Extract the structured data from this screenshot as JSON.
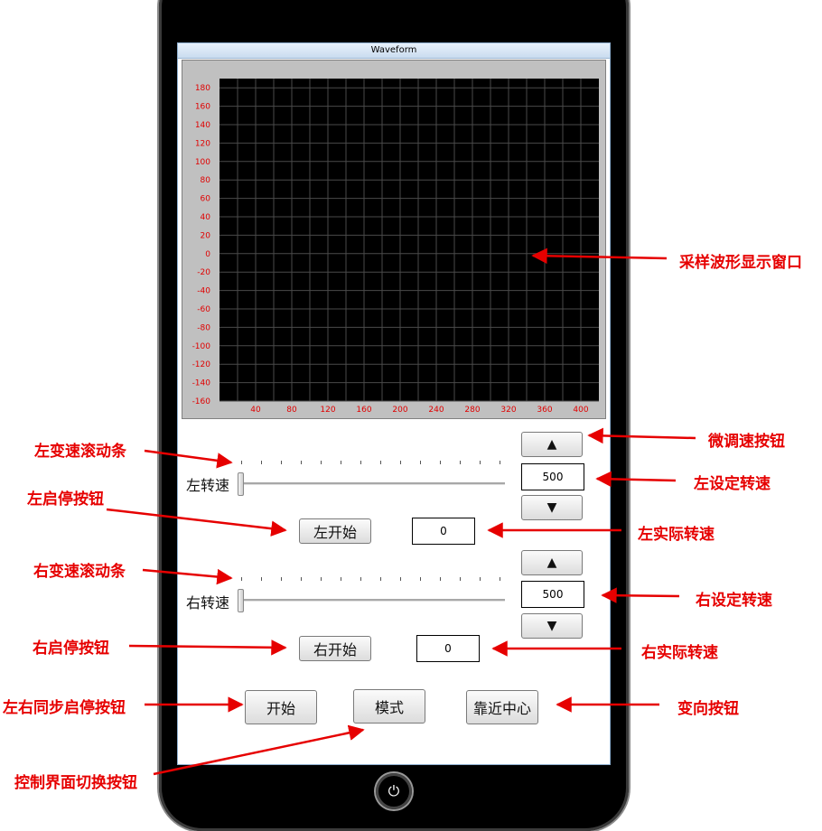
{
  "window": {
    "title": "Waveform"
  },
  "chart_data": {
    "type": "line",
    "series": [],
    "x_ticks": [
      "40",
      "80",
      "120",
      "160",
      "200",
      "240",
      "280",
      "320",
      "360",
      "400"
    ],
    "y_ticks": [
      "180",
      "160",
      "140",
      "120",
      "100",
      "80",
      "60",
      "40",
      "20",
      "0",
      "-20",
      "-40",
      "-60",
      "-80",
      "-100",
      "-120",
      "-140",
      "-160"
    ],
    "xlim": [
      0,
      420
    ],
    "ylim": [
      -160,
      190
    ],
    "grid": true,
    "background": "#000000",
    "grid_color": "#4a4a4a",
    "tick_label_color": "#e00000"
  },
  "left_motor": {
    "up_label": "▲",
    "set_speed": "500",
    "down_label": "▼",
    "slider_label": "左转速",
    "slider_value": 0,
    "start_label": "左开始",
    "actual_speed": "0"
  },
  "right_motor": {
    "up_label": "▲",
    "set_speed": "500",
    "down_label": "▼",
    "slider_label": "右转速",
    "slider_value": 0,
    "start_label": "右开始",
    "actual_speed": "0"
  },
  "bottom_buttons": {
    "start": "开始",
    "mode": "模式",
    "center": "靠近中心"
  },
  "home_icon": "power-icon",
  "annotations": {
    "waveform_window": "采样波形显示窗口",
    "fine_tune": "微调速按钮",
    "left_set_speed": "左设定转速",
    "left_actual_speed": "左实际转速",
    "right_set_speed": "右设定转速",
    "right_actual_speed": "右实际转速",
    "direction": "变向按钮",
    "left_slider": "左变速滚动条",
    "left_start_stop": "左启停按钮",
    "right_slider": "右变速滚动条",
    "right_start_stop": "右启停按钮",
    "sync_start_stop": "左右同步启停按钮",
    "switch_ui": "控制界面切换按钮"
  },
  "colors": {
    "annotation": "#e60000",
    "frame": "#000000"
  }
}
